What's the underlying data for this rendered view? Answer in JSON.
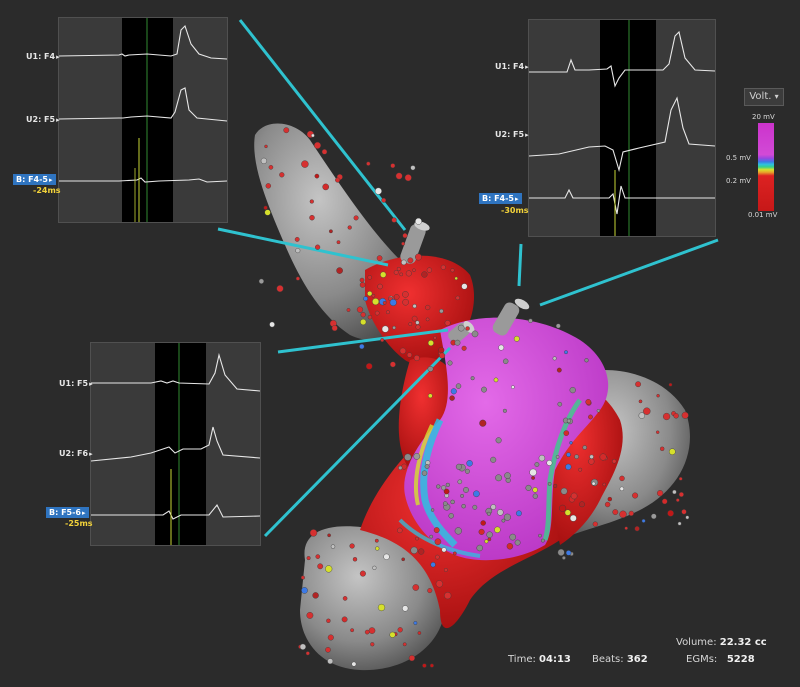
{
  "panels": [
    {
      "channels": [
        "U1: F4",
        "U2: F5"
      ],
      "reference": "B: F4-5",
      "lat": "-24ms"
    },
    {
      "channels": [
        "U1: F4",
        "U2: F5"
      ],
      "reference": "B: F4-5",
      "lat": "-30ms"
    },
    {
      "channels": [
        "U1: F5",
        "U2: F6"
      ],
      "reference": "B: F5-6",
      "lat": "-25ms"
    }
  ],
  "voltage_scale": {
    "selector": "Volt.",
    "ticks": [
      "20 mV",
      "0.5 mV",
      "0.2 mV",
      "0.01 mV"
    ],
    "colors": {
      "high": "#cc33cc",
      "mid": "#2ec0e0",
      "low": "#dd2222"
    }
  },
  "stats": {
    "time_label": "Time:",
    "time_value": "04:13",
    "beats_label": "Beats:",
    "beats_value": "362",
    "volume_label": "Volume:",
    "volume_value": "22.32 cc",
    "egms_label": "EGMs:",
    "egms_value": "5228"
  },
  "accent_color": "#2fc2cf"
}
